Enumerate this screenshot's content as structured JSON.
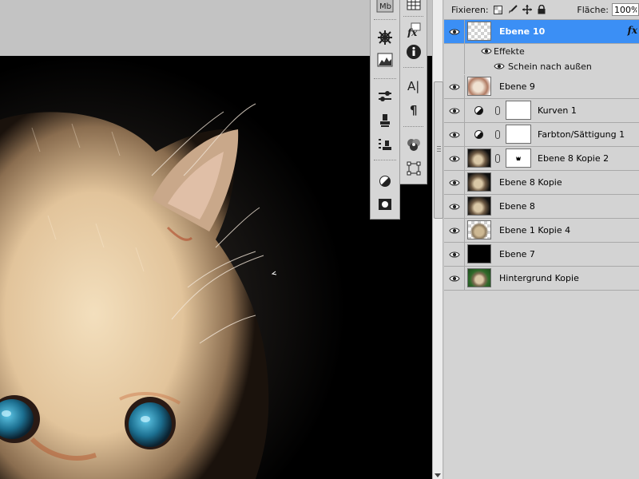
{
  "layers_panel": {
    "lock_label": "Fixieren:",
    "fill_label": "Fläche:",
    "fill_value": "100%",
    "selected_color": "#3b8ff5",
    "layers": [
      {
        "name": "Ebene 10",
        "selected": true,
        "thumb": "transparent",
        "has_fx": true,
        "fx": "fx"
      },
      {
        "name": "Ebene 9",
        "thumb": "cat-soft"
      },
      {
        "name": "Kurven 1",
        "thumb": "adjustment",
        "mask": "white"
      },
      {
        "name": "Farbton/Sättigung 1",
        "thumb": "adjustment",
        "mask": "white"
      },
      {
        "name": "Ebene 8 Kopie 2",
        "thumb": "cat-dark",
        "mask": "cat-mask"
      },
      {
        "name": "Ebene 8 Kopie",
        "thumb": "cat-dark"
      },
      {
        "name": "Ebene 8",
        "thumb": "cat-dark"
      },
      {
        "name": "Ebene 1 Kopie 4",
        "thumb": "cat-transparent"
      },
      {
        "name": "Ebene 7",
        "thumb": "black"
      },
      {
        "name": "Hintergrund Kopie",
        "thumb": "cat-green"
      }
    ],
    "effects_label": "Effekte",
    "effect_item": "Schein nach außen"
  },
  "tools": {
    "palette_1": [
      "mini-bridge-icon",
      "navigator-wheel-icon",
      "histogram-icon",
      "brushes-icon",
      "clone-source-icon",
      "tool-presets-icon",
      "adjustments-icon",
      "masks-icon"
    ],
    "palette_2": [
      "swatches-grid-icon",
      "styles-fx-icon",
      "info-icon",
      "character-icon",
      "paragraph-icon",
      "channels-icon",
      "paths-icon"
    ],
    "mb_label": "Mb",
    "fx_label": "fx",
    "character_label": "A|",
    "paragraph_label": "¶"
  },
  "icons": {
    "visibility": "eye-icon",
    "lock_transparent": "lock-transparent-icon",
    "lock_brush": "lock-brush-icon",
    "lock_move": "lock-move-icon",
    "lock_all": "lock-all-icon",
    "link": "chain-icon"
  }
}
